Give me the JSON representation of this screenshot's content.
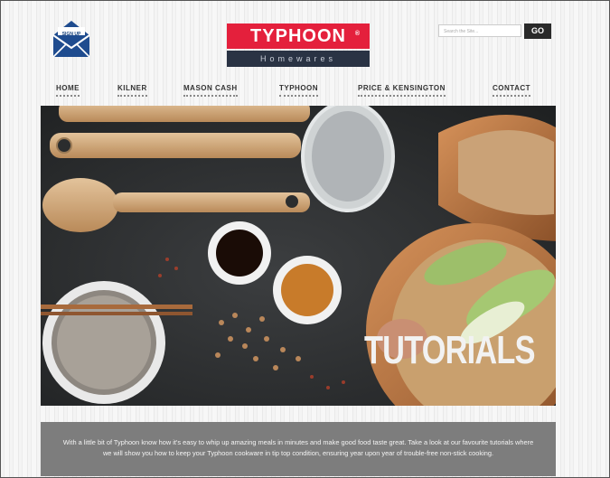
{
  "header": {
    "signup_label": "SIGN UP",
    "logo": {
      "brand": "TYPHOON",
      "reg": "®",
      "sub": "Homewares"
    },
    "search": {
      "placeholder": "Search the Site...",
      "go_label": "GO"
    }
  },
  "nav": {
    "items": [
      {
        "label": "HOME"
      },
      {
        "label": "KILNER"
      },
      {
        "label": "MASON CASH"
      },
      {
        "label": "TYPHOON"
      },
      {
        "label": "PRICE & KENSINGTON"
      },
      {
        "label": "CONTACT"
      }
    ]
  },
  "hero": {
    "title": "TUTORIALS"
  },
  "intro": {
    "text": "With a little bit of Typhoon know how it's easy to whip up amazing meals in minutes and make good food taste great. Take a look at our favourite tutorials where we will show you how to keep your Typhoon cookware in tip top condition, ensuring year upon year of trouble-free non-stick cooking."
  },
  "colors": {
    "brand_red": "#e4203c",
    "brand_navy": "#2a3344",
    "envelope_blue": "#1f4c8f",
    "intro_bg": "#7d7d7d"
  }
}
